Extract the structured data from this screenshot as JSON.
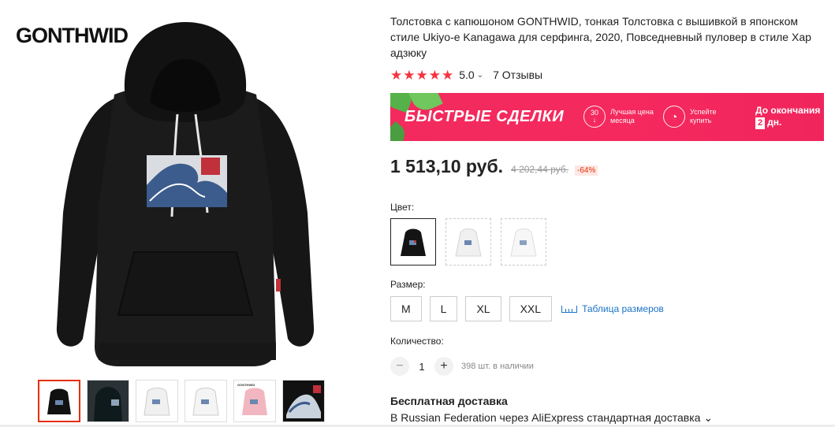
{
  "brand": "GONTHWID",
  "product": {
    "title": "Толстовка с капюшоном GONTHWID, тонкая Толстовка с вышивкой в японском стиле Ukiyo-e Kanagawa для серфинга, 2020, Повседневный пуловер в стиле Хар адзюку",
    "rating": "5.0",
    "rating_chevron": "⌄",
    "reviews": "7 Отзывы",
    "stars": 5
  },
  "deals": {
    "title": "БЫСТРЫЕ СДЕЛКИ",
    "item1_icon_num": "30",
    "item1_text": "Лучшая цена месяца",
    "item2_text": "Успейте купить",
    "countdown_label": "До окончания",
    "countdown_days": "2",
    "countdown_unit": "дн.",
    "colors": {
      "bg": "#f22a5d",
      "leaf": "#4caf50"
    }
  },
  "price": {
    "current": "1 513,10 руб.",
    "old": "4 202,44 руб.",
    "discount": "-64%"
  },
  "color_section": {
    "label": "Цвет:",
    "options": [
      "black",
      "white",
      "white-light"
    ],
    "selected": 0
  },
  "size_section": {
    "label": "Размер:",
    "sizes": [
      "M",
      "L",
      "XL",
      "XXL"
    ],
    "size_chart": "Таблица размеров"
  },
  "quantity": {
    "label": "Количество:",
    "value": "1",
    "minus": "−",
    "plus": "+",
    "stock": "398 шт. в наличии"
  },
  "shipping": {
    "title": "Бесплатная доставка",
    "desc": "В Russian Federation через AliExpress стандартная доставка ⌄"
  },
  "gallery": {
    "thumbnails": [
      "black-hoodie",
      "model-photo",
      "white-hoodie",
      "white-hoodie-2",
      "pink-hoodie",
      "wave-closeup"
    ],
    "active": 0
  }
}
